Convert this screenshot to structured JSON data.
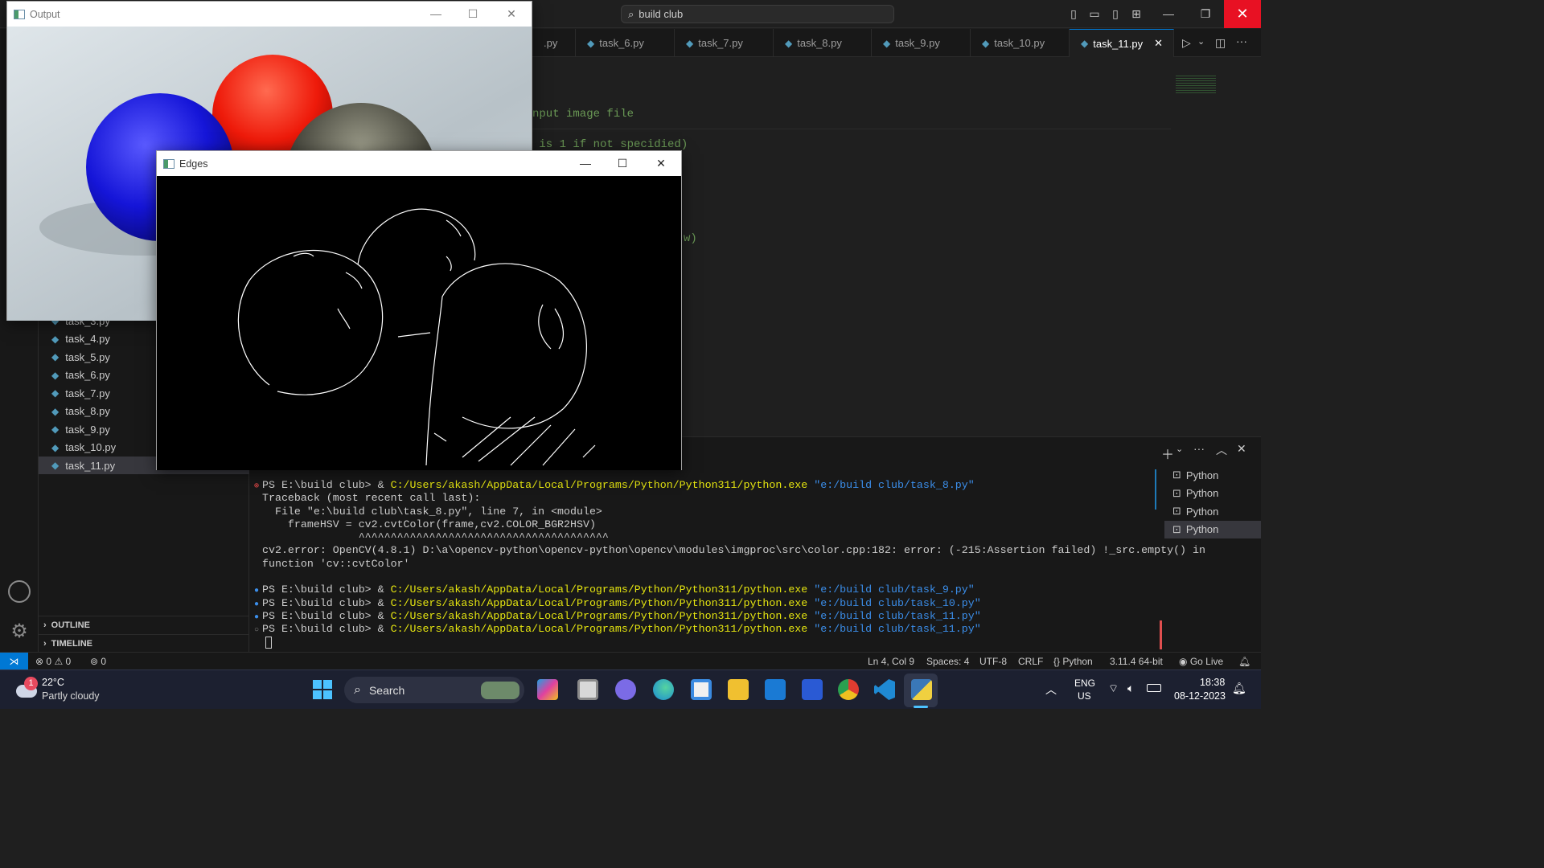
{
  "titlebar": {
    "search_text": "build club",
    "icons": [
      "toggle-primary-sidebar-icon",
      "toggle-panel-icon",
      "toggle-secondary-sidebar-icon",
      "customize-layout-icon"
    ]
  },
  "tabs": [
    {
      "label": ".py"
    },
    {
      "label": "task_6.py"
    },
    {
      "label": "task_7.py"
    },
    {
      "label": "task_8.py"
    },
    {
      "label": "task_9.py"
    },
    {
      "label": "task_10.py"
    },
    {
      "label": "task_11.py",
      "active": true
    }
  ],
  "editor": {
    "lines": [
      "nput image file",
      " is 1 if not specidied)",
      "w)"
    ]
  },
  "sidebar": {
    "files": [
      "task_3.py",
      "task_4.py",
      "task_5.py",
      "task_6.py",
      "task_7.py",
      "task_8.py",
      "task_9.py",
      "task_10.py",
      "task_11.py"
    ],
    "outline_label": "OUTLINE",
    "timeline_label": "TIMELINE"
  },
  "terminal": {
    "prompt": "PS E:\\build club> & ",
    "exe": "C:/Users/akash/AppData/Local/Programs/Python/Python311/python.exe",
    "lines": [
      {
        "kind": "cmd",
        "status": "error",
        "arg": "\"e:/build club/task_8.py\""
      },
      {
        "kind": "text",
        "text": "Traceback (most recent call last):"
      },
      {
        "kind": "text",
        "text": "  File \"e:\\build club\\task_8.py\", line 7, in <module>"
      },
      {
        "kind": "text",
        "text": "    frameHSV = cv2.cvtColor(frame,cv2.COLOR_BGR2HSV)"
      },
      {
        "kind": "text",
        "text": "               ^^^^^^^^^^^^^^^^^^^^^^^^^^^^^^^^^^^^^^^"
      },
      {
        "kind": "text",
        "text": "cv2.error: OpenCV(4.8.1) D:\\a\\opencv-python\\opencv-python\\opencv\\modules\\imgproc\\src\\color.cpp:182: error: (-215:Assertion failed) !_src.empty() in"
      },
      {
        "kind": "text",
        "text": "function 'cv::cvtColor'"
      },
      {
        "kind": "text",
        "text": ""
      },
      {
        "kind": "cmd",
        "status": "ok",
        "arg": "\"e:/build club/task_9.py\""
      },
      {
        "kind": "cmd",
        "status": "ok",
        "arg": "\"e:/build club/task_10.py\""
      },
      {
        "kind": "cmd",
        "status": "ok",
        "arg": "\"e:/build club/task_11.py\""
      },
      {
        "kind": "cmd",
        "status": "pending",
        "arg": "\"e:/build club/task_11.py\""
      }
    ],
    "instances": [
      "Python",
      "Python",
      "Python",
      "Python"
    ]
  },
  "statusbar": {
    "errors": "0",
    "warnings": "0",
    "ports": "0",
    "position": "Ln 4, Col 9",
    "spaces": "Spaces: 4",
    "encoding": "UTF-8",
    "eol": "CRLF",
    "language": "Python",
    "interpreter": "3.11.4 64-bit",
    "golive": "Go Live"
  },
  "windows": {
    "output_title": "Output",
    "edges_title": "Edges"
  },
  "taskbar": {
    "weather_temp": "22°C",
    "weather_desc": "Partly cloudy",
    "weather_badge": "1",
    "search_label": "Search",
    "lang_top": "ENG",
    "lang_bottom": "US",
    "time": "18:38",
    "date": "08-12-2023"
  },
  "colors": {
    "accent": "#0078d4",
    "close_red": "#e81123",
    "terminal_yellow": "#e5e510",
    "terminal_blue": "#3b8eea"
  }
}
